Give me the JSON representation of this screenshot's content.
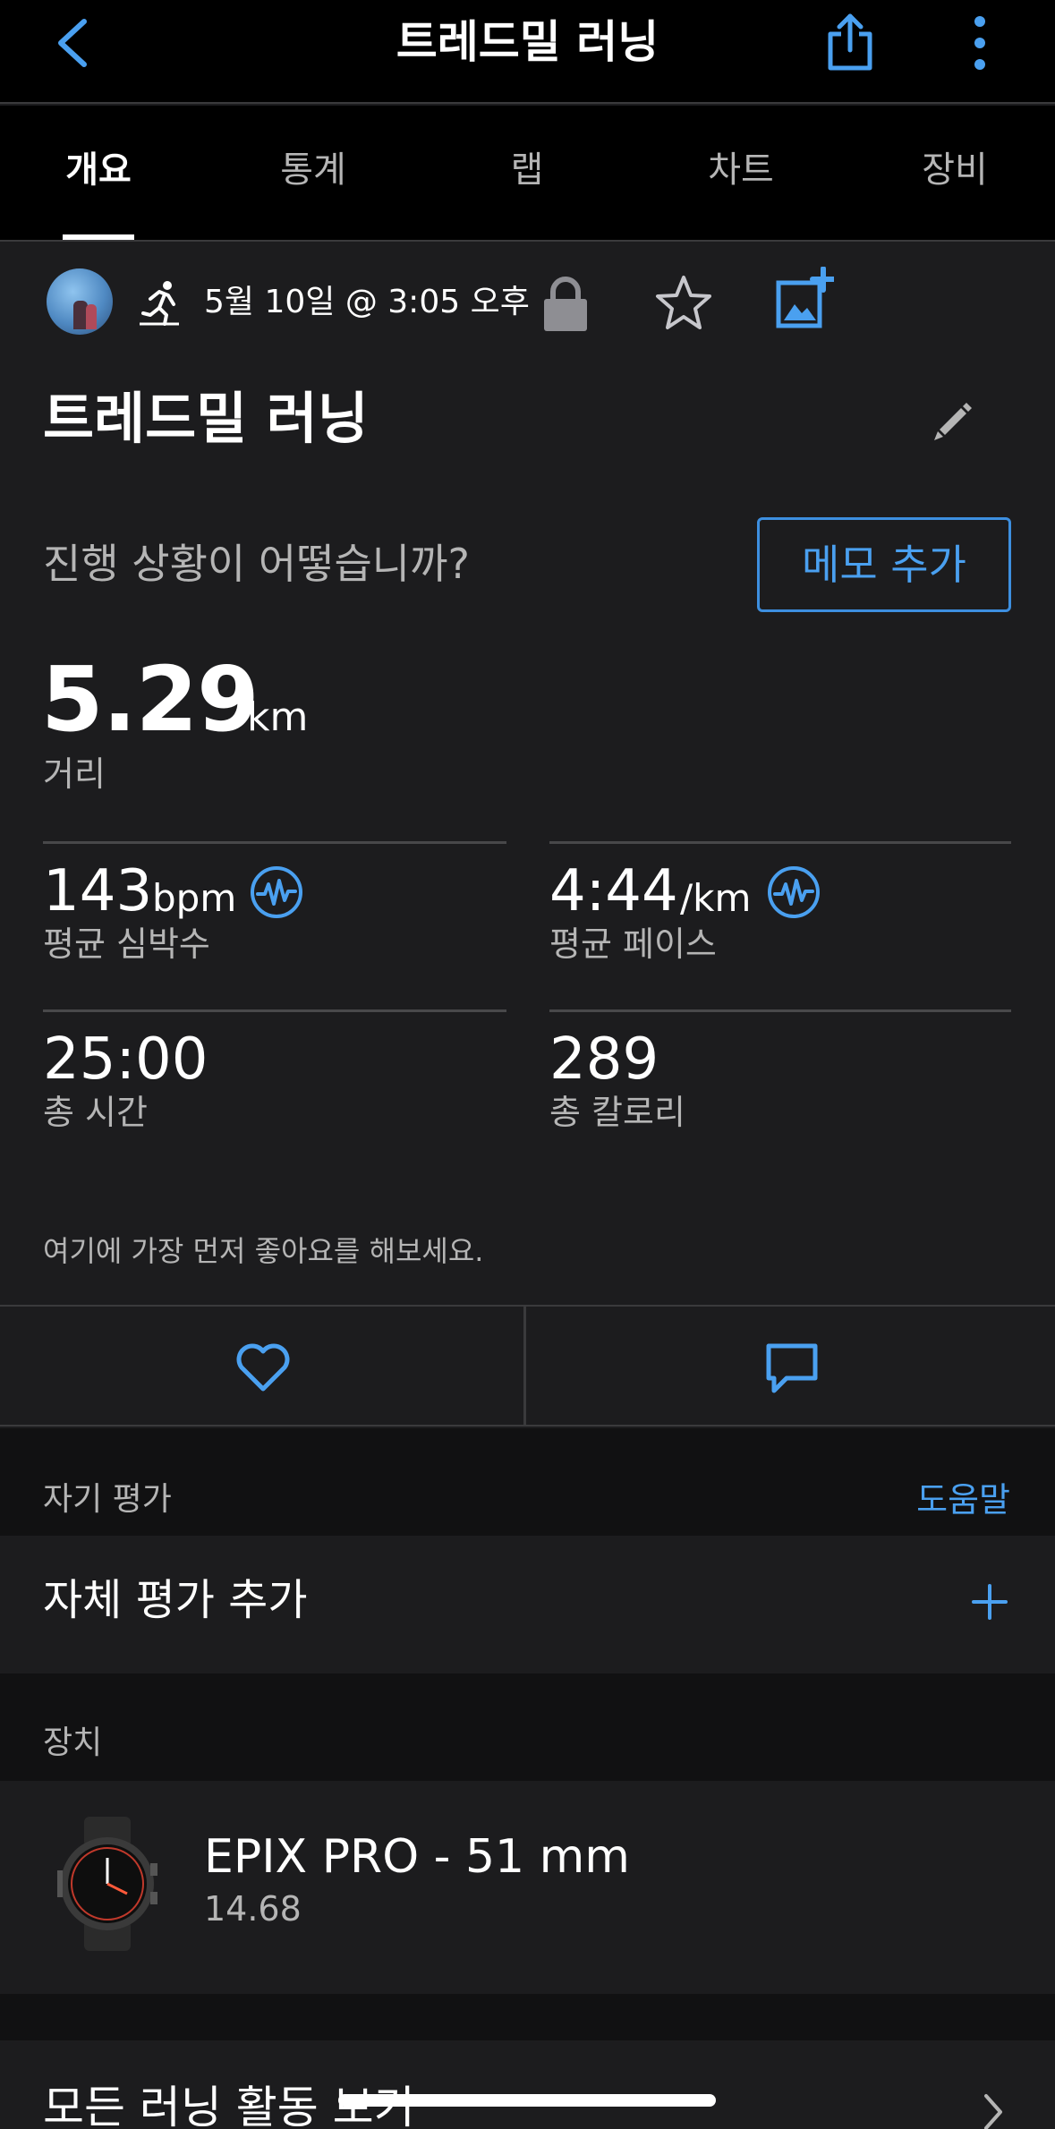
{
  "header": {
    "title": "트레드밀 러닝",
    "back_icon": "chevron-left-icon",
    "share_icon": "share-icon",
    "more_icon": "more-vertical-icon"
  },
  "tabs": [
    {
      "label": "개요",
      "active": true
    },
    {
      "label": "통계",
      "active": false
    },
    {
      "label": "랩",
      "active": false
    },
    {
      "label": "차트",
      "active": false
    },
    {
      "label": "장비",
      "active": false
    }
  ],
  "activity": {
    "date": "5월 10일 @ 3:05 오후",
    "title": "트레드밀 러닝",
    "prompt": "진행 상황이 어떻습니까?",
    "memo_button": "메모 추가"
  },
  "distance": {
    "value": "5.29",
    "unit": "km",
    "label": "거리"
  },
  "stats": {
    "heart_rate": {
      "value": "143",
      "unit": "bpm",
      "label": "평균 심박수"
    },
    "pace": {
      "value": "4:44",
      "unit": "/km",
      "label": "평균 페이스"
    },
    "time": {
      "value": "25:00",
      "label": "총 시간"
    },
    "calories": {
      "value": "289",
      "label": "총 칼로리"
    }
  },
  "social": {
    "like_prompt": "여기에 가장 먼저 좋아요를 해보세요."
  },
  "self_eval": {
    "section_label": "자기 평가",
    "help_link": "도움말",
    "add_label": "자체 평가 추가"
  },
  "device": {
    "section_label": "장치",
    "name": "EPIX PRO - 51 mm",
    "version": "14.68"
  },
  "footer": {
    "all_runs": "모든 러닝 활동 보기"
  },
  "colors": {
    "accent": "#4aa0f0",
    "background": "#1c1c1e",
    "navbar": "#000000",
    "section": "#111112"
  }
}
